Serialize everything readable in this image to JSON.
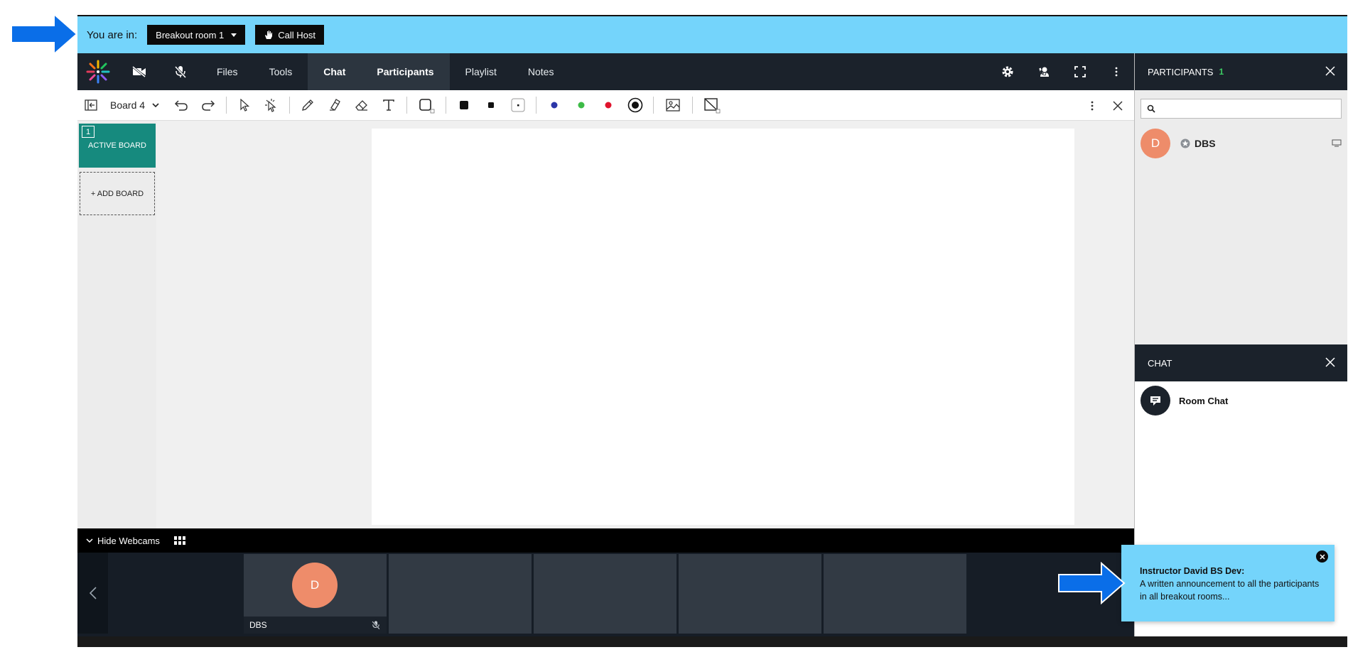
{
  "banner": {
    "label": "You are in:",
    "room": "Breakout room 1",
    "call_host": "Call Host"
  },
  "nav": {
    "tabs": [
      {
        "label": "Files",
        "active": false
      },
      {
        "label": "Tools",
        "active": false
      },
      {
        "label": "Chat",
        "active": true
      },
      {
        "label": "Participants",
        "active": true
      },
      {
        "label": "Playlist",
        "active": false
      },
      {
        "label": "Notes",
        "active": false
      }
    ]
  },
  "toolbar": {
    "board_name": "Board 4",
    "colors": [
      "#2b36a8",
      "#3dbb47",
      "#e0142d"
    ]
  },
  "boards": {
    "active_number": "1",
    "active_label": "ACTIVE BOARD",
    "add_label": "+ ADD BOARD"
  },
  "zoom": {
    "in": "+",
    "out": "−"
  },
  "webcams": {
    "toggle_label": "Hide Webcams",
    "tiles": [
      {
        "initial": "D",
        "name": "DBS"
      }
    ]
  },
  "participants": {
    "title": "PARTICIPANTS",
    "count": "1",
    "list": [
      {
        "initial": "D",
        "name": "DBS"
      }
    ]
  },
  "chat": {
    "title": "CHAT",
    "room_chat_label": "Room Chat"
  },
  "notification": {
    "title": "Instructor David BS Dev:",
    "message": "A written announcement to all the participants in all breakout rooms..."
  },
  "colors": {
    "banner": "#74d4fb",
    "arrow": "#0a6ee8",
    "teal": "#168a7e",
    "avatar": "#ee8c6a",
    "nav": "#1b222b"
  }
}
